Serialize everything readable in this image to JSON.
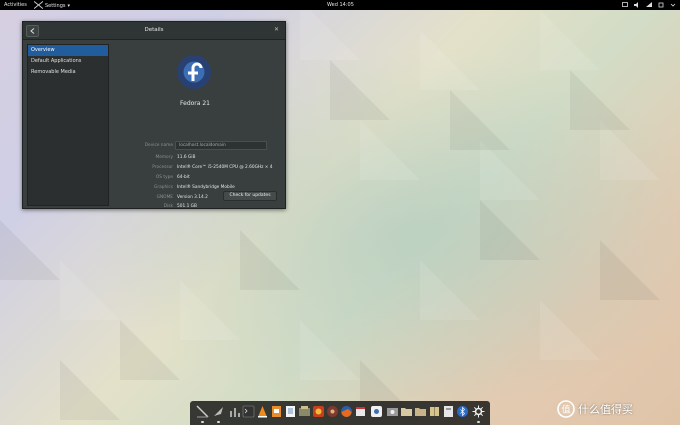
{
  "topbar": {
    "activities": "Activities",
    "app_menu": "Settings",
    "clock": "Wed 14:05"
  },
  "window": {
    "title": "Details",
    "sidebar": [
      "Overview",
      "Default Applications",
      "Removable Media"
    ],
    "os_name": "Fedora 21",
    "device_name_label": "Device name",
    "device_name_value": "localhost.localdomain",
    "specs": [
      {
        "label": "Memory",
        "value": "11.6 GiB"
      },
      {
        "label": "Processor",
        "value": "Intel® Core™ i5-2540M CPU @ 2.60GHz × 4"
      },
      {
        "label": "OS type",
        "value": "64-bit"
      },
      {
        "label": "Graphics",
        "value": "Intel® Sandybridge Mobile"
      },
      {
        "label": "GNOME",
        "value": "Version 3.14.2"
      },
      {
        "label": "Disk",
        "value": "501.1 GB"
      }
    ],
    "update_button": "Check for updates"
  },
  "watermark": "什么值得买",
  "colors": {
    "selection": "#215d9c",
    "window_bg": "#393f3f",
    "fedora_blue": "#294172"
  },
  "icons": {
    "dock": [
      "drawing-app-icon",
      "rocket-app-icon",
      "terminal-icon",
      "vlc-icon",
      "libreoffice-impress-icon",
      "document-viewer-icon",
      "nautilus-icon",
      "ubuntu-software-icon",
      "firefox-icon",
      "gimp-icon",
      "calendar-app-icon",
      "music-player-icon",
      "photos-icon",
      "folder-icon",
      "folder-icon",
      "archive-manager-icon",
      "files-icon",
      "bluetooth-icon",
      "settings-gear-icon"
    ]
  }
}
